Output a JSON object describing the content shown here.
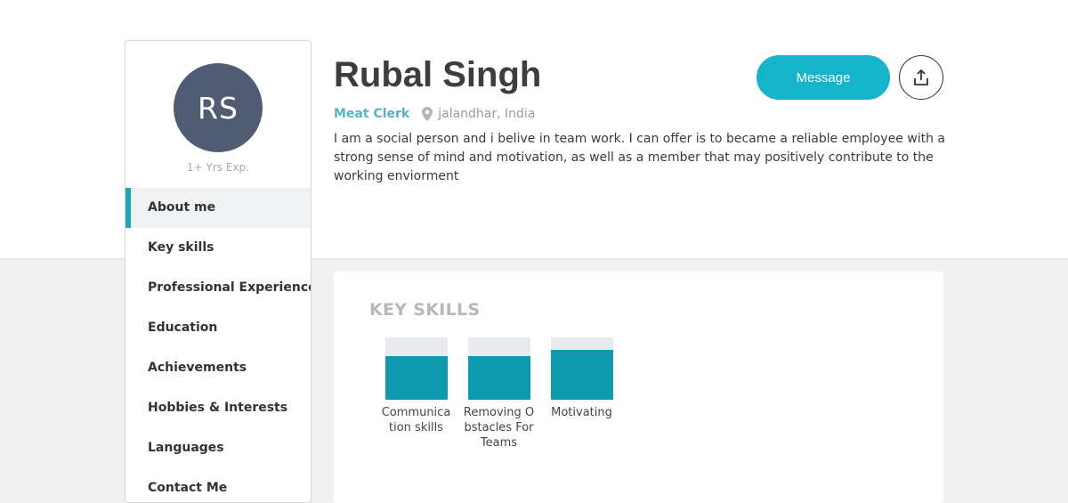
{
  "profile": {
    "initials": "RS",
    "experience": "1+ Yrs Exp.",
    "name": "Rubal Singh",
    "role": "Meat Clerk",
    "location": "jalandhar, India",
    "about": "I am a social person and i belive in team work. I can offer is to became a reliable employee with a strong sense of mind and motivation, as well as a member that may positively contribute to the working enviorment"
  },
  "actions": {
    "message_label": "Message",
    "share_icon": "share-upload-icon"
  },
  "sidebar": {
    "items": [
      {
        "label": "About me",
        "active": true
      },
      {
        "label": "Key skills",
        "active": false
      },
      {
        "label": "Professional Experience",
        "active": false
      },
      {
        "label": "Education",
        "active": false
      },
      {
        "label": "Achievements",
        "active": false
      },
      {
        "label": "Hobbies & Interests",
        "active": false
      },
      {
        "label": "Languages",
        "active": false
      },
      {
        "label": "Contact Me",
        "active": false
      }
    ]
  },
  "key_skills": {
    "title": "KEY SKILLS",
    "items": [
      {
        "label": "Communication skills",
        "level": 0.7
      },
      {
        "label": "Removing Obstacles For Teams",
        "level": 0.7
      },
      {
        "label": "Motivating",
        "level": 0.8
      }
    ]
  },
  "colors": {
    "accent": "#15b4cb",
    "bar_fill": "#0f9aaf",
    "avatar_bg": "#515b72",
    "role_text": "#55b5c5"
  }
}
